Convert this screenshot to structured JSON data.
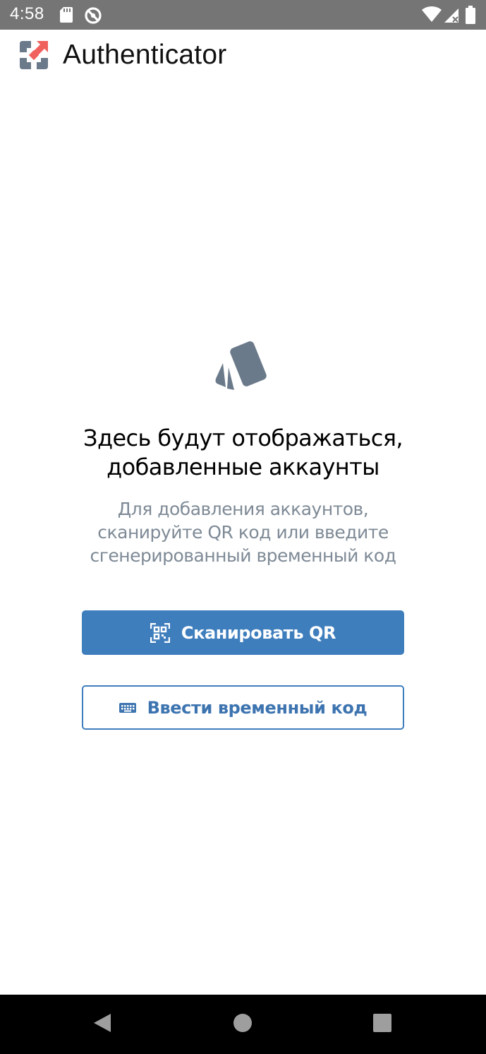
{
  "status_bar": {
    "time": "4:58",
    "icons": [
      "sd-card-icon",
      "sync-disabled-icon",
      "wifi-icon",
      "signal-icon",
      "battery-icon"
    ]
  },
  "app_bar": {
    "title": "Authenticator",
    "logo_icon": "authenticator-logo-icon"
  },
  "empty_state": {
    "icon": "cards-icon",
    "title_lines": [
      "Здесь будут отображаться,",
      "добавленные аккаунты"
    ],
    "desc_lines": [
      "Для добавления аккаунтов,",
      "сканируйте QR код или введите",
      "сгенерированный временный код"
    ]
  },
  "actions": {
    "scan_qr_label": "Сканировать QR",
    "scan_qr_icon": "qr-scan-icon",
    "enter_code_label": "Ввести временный код",
    "enter_code_icon": "keyboard-icon"
  },
  "nav_bar": {
    "icons": [
      "back-icon",
      "home-icon",
      "recents-icon"
    ]
  },
  "colors": {
    "status_bar_bg": "#757575",
    "primary": "#3f7ebd",
    "logo_red": "#f0605d",
    "logo_gray": "#6b7a8a",
    "muted_text": "#7e8a96"
  }
}
